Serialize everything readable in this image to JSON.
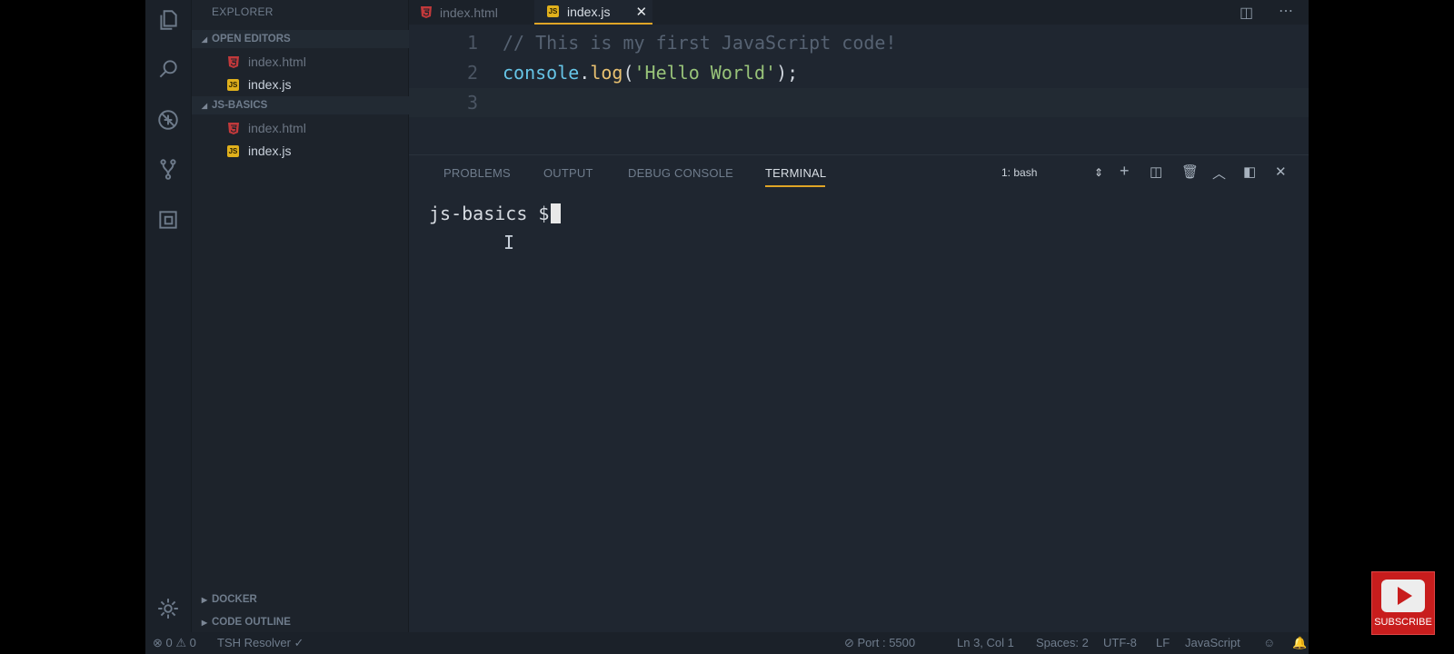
{
  "sidebar": {
    "title": "EXPLORER",
    "open_editors": "OPEN EDITORS",
    "open_files": [
      "index.html",
      "index.js"
    ],
    "project": "JS-BASICS",
    "project_files": [
      "index.html",
      "index.js"
    ],
    "docker": "DOCKER",
    "code_outline": "CODE OUTLINE"
  },
  "tabs": [
    {
      "label": "index.html",
      "icon": "html5-icon"
    },
    {
      "label": "index.js",
      "icon": "js-icon",
      "close": "✕"
    }
  ],
  "editor": {
    "lines": [
      {
        "num": "1",
        "comment": "// This is my first JavaScript code!"
      },
      {
        "num": "2",
        "ident": "console",
        "dot": ".",
        "fn": "log",
        "open": "(",
        "str": "'Hello World'",
        "close": ");"
      },
      {
        "num": "3"
      }
    ]
  },
  "panel": {
    "tabs": [
      "PROBLEMS",
      "OUTPUT",
      "DEBUG CONSOLE",
      "TERMINAL"
    ],
    "active_tab": "TERMINAL",
    "shell": "1: bash",
    "prompt": "js-basics $"
  },
  "status": {
    "errors": "0",
    "warnings": "0",
    "resolver": "TSH Resolver ✓",
    "port": "Port : 5500",
    "position": "Ln 3, Col 1",
    "spaces": "Spaces: 2",
    "encoding": "UTF-8",
    "eol": "LF",
    "language": "JavaScript"
  },
  "subscribe": {
    "label": "SUBSCRIBE"
  },
  "colors": {
    "accent": "#e0a526",
    "subscribe_red": "#c81d1d",
    "html_icon": "#c2393b",
    "js_icon": "#e0b01c"
  }
}
